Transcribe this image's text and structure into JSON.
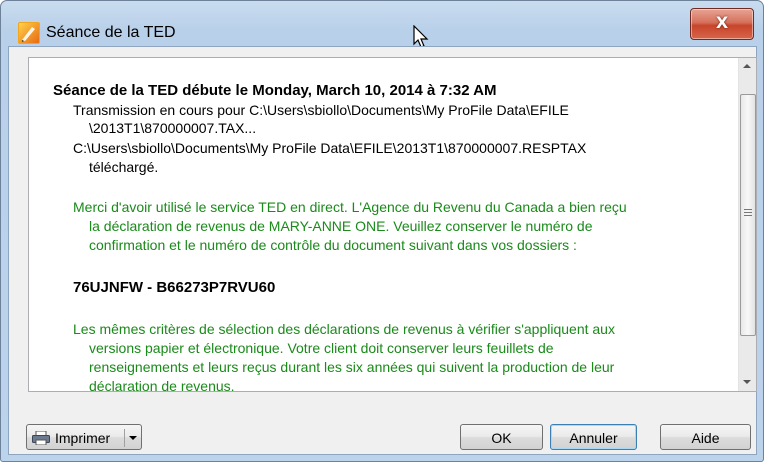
{
  "window": {
    "title": "Séance de la TED",
    "close_label": "X"
  },
  "log": {
    "header": "Séance de la TED débute le Monday, March 10, 2014 à 7:32 AM",
    "lines": [
      "Transmission en cours pour C:\\Users\\sbiollo\\Documents\\My ProFile Data\\EFILE",
      "\\2013T1\\870000007.TAX...",
      "C:\\Users\\sbiollo\\Documents\\My ProFile Data\\EFILE\\2013T1\\870000007.RESPTAX",
      "téléchargé."
    ],
    "thanks_lines": [
      "Merci d'avoir utilisé le service TED en direct. L'Agence du Revenu du Canada a bien reçu",
      "la déclaration de revenus de MARY-ANNE ONE. Veuillez conserver le numéro de",
      "confirmation et le numéro de contrôle du document suivant dans vos dossiers :"
    ],
    "confirmation": "76UJNFW - B66273P7RVU60",
    "criteria_lines": [
      "Les mêmes critères de sélection des déclarations de revenus à vérifier s'appliquent aux",
      "versions papier et électronique. Votre client doit conserver leurs feuillets de",
      "renseignements et leurs reçus durant les six années qui suivent la production de leur",
      "déclaration de revenus."
    ]
  },
  "buttons": {
    "print": "Imprimer",
    "ok": "OK",
    "cancel": "Annuler",
    "help": "Aide"
  },
  "colors": {
    "accent_green": "#1a8a1a",
    "title_bar": "#b9d0ea",
    "close_red": "#c7452b"
  },
  "icons": {
    "app": "profile-app-icon",
    "cursor": "mouse-cursor-icon",
    "print": "printer-icon"
  }
}
